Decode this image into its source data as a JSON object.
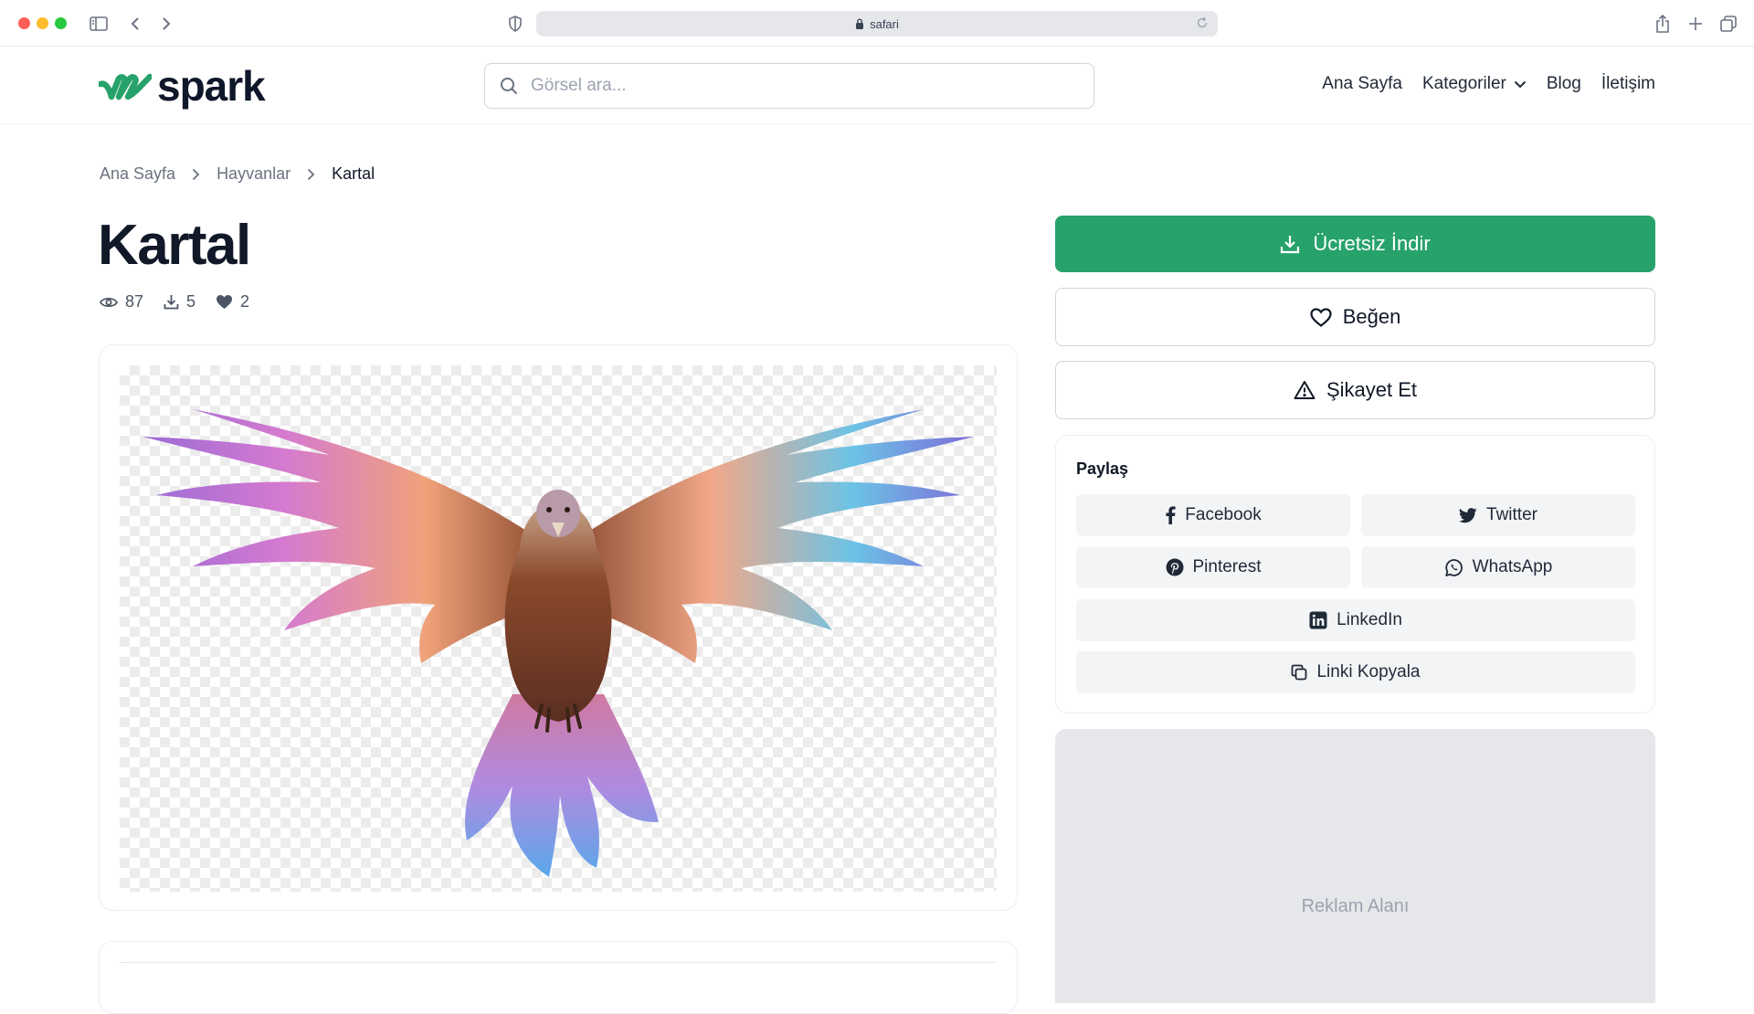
{
  "browser": {
    "address": "safari"
  },
  "header": {
    "logo_text": "spark",
    "search_placeholder": "Görsel ara...",
    "nav": [
      {
        "label": "Ana Sayfa"
      },
      {
        "label": "Kategoriler"
      },
      {
        "label": "Blog"
      },
      {
        "label": "İletişim"
      }
    ]
  },
  "breadcrumb": [
    "Ana Sayfa",
    "Hayvanlar",
    "Kartal"
  ],
  "page": {
    "title": "Kartal",
    "stats": {
      "views": "87",
      "downloads": "5",
      "likes": "2"
    }
  },
  "actions": {
    "download_label": "Ücretsiz İndir",
    "like_label": "Beğen",
    "report_label": "Şikayet Et"
  },
  "share": {
    "title": "Paylaş",
    "facebook": "Facebook",
    "twitter": "Twitter",
    "pinterest": "Pinterest",
    "whatsapp": "WhatsApp",
    "linkedin": "LinkedIn",
    "copy_link": "Linki Kopyala"
  },
  "ad": {
    "label": "Reklam Alanı"
  },
  "colors": {
    "brand_green": "#27a26b",
    "ad_background": "#e5e7eb"
  }
}
